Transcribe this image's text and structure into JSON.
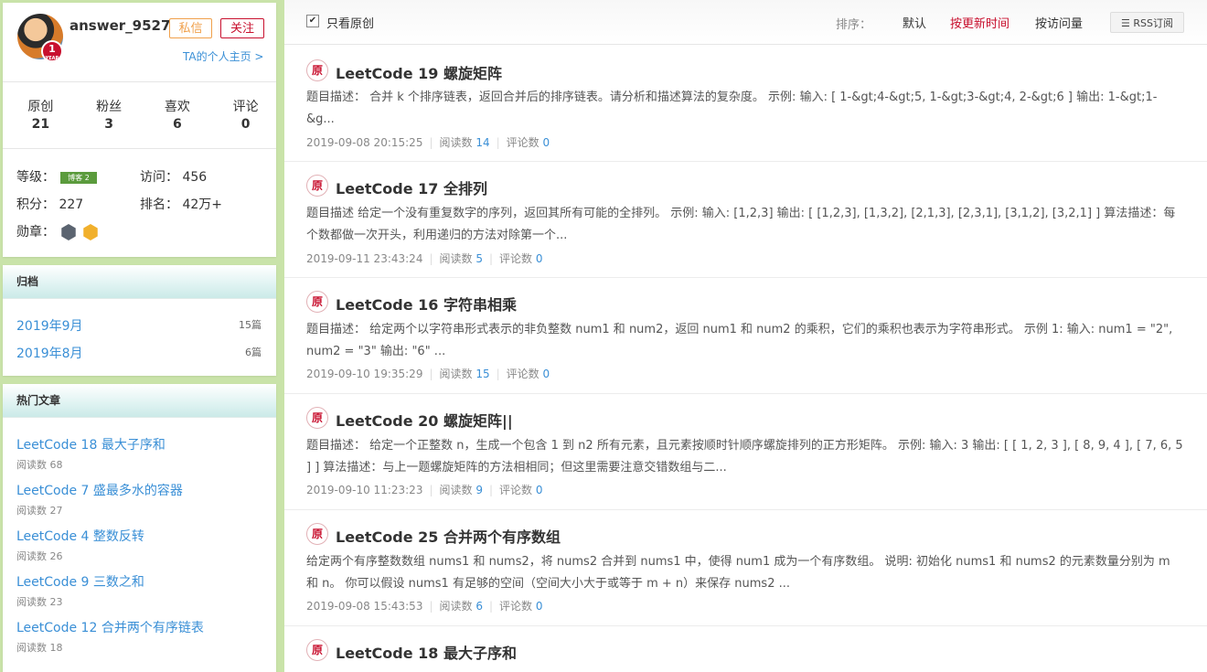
{
  "profile": {
    "username": "answer_9527",
    "level_badge_num": "1",
    "level_badge_word": "YEAR",
    "message_label": "私信",
    "follow_label": "关注",
    "homepage_label": "TA的个人主页 >",
    "stats": [
      {
        "label": "原创",
        "value": "21"
      },
      {
        "label": "粉丝",
        "value": "3"
      },
      {
        "label": "喜欢",
        "value": "6"
      },
      {
        "label": "评论",
        "value": "0"
      }
    ],
    "level_label": "等级：",
    "level_tag": "博客 2",
    "visits_label": "访问：",
    "visits_value": "456",
    "points_label": "积分：",
    "points_value": "227",
    "rank_label": "排名：",
    "rank_value": "42万+",
    "medals_label": "勋章："
  },
  "archive": {
    "title": "归档",
    "items": [
      {
        "label": "2019年9月",
        "count": "15篇"
      },
      {
        "label": "2019年8月",
        "count": "6篇"
      }
    ]
  },
  "hot": {
    "title": "热门文章",
    "items": [
      {
        "title": "LeetCode 18 最大子序和",
        "reads": "阅读数 68"
      },
      {
        "title": "LeetCode 7 盛最多水的容器",
        "reads": "阅读数 27"
      },
      {
        "title": "LeetCode 4 整数反转",
        "reads": "阅读数 26"
      },
      {
        "title": "LeetCode 9 三数之和",
        "reads": "阅读数 23"
      },
      {
        "title": "LeetCode 12 合并两个有序链表",
        "reads": "阅读数 18"
      }
    ]
  },
  "toolbar": {
    "only_original": "只看原创",
    "sort_label": "排序：",
    "sort_default": "默认",
    "sort_by_time": "按更新时间",
    "sort_by_views": "按访问量",
    "rss_label": "RSS订阅"
  },
  "posts": [
    {
      "badge": "原",
      "title": "LeetCode 19 螺旋矩阵",
      "desc": "题目描述： 合并 k 个排序链表，返回合并后的排序链表。请分析和描述算法的复杂度。 示例: 输入: [ 1-&gt;4-&gt;5, 1-&gt;3-&gt;4, 2-&gt;6 ] 输出: 1-&gt;1-&g...",
      "date": "2019-09-08 20:15:25",
      "read_label": "阅读数",
      "reads": "14",
      "comment_label": "评论数",
      "comments": "0"
    },
    {
      "badge": "原",
      "title": "LeetCode 17 全排列",
      "desc": "题目描述 给定一个没有重复数字的序列，返回其所有可能的全排列。 示例: 输入: [1,2,3] 输出: [ [1,2,3], [1,3,2], [2,1,3], [2,3,1], [3,1,2], [3,2,1] ] 算法描述：每个数都做一次开头，利用递归的方法对除第一个...",
      "date": "2019-09-11 23:43:24",
      "read_label": "阅读数",
      "reads": "5",
      "comment_label": "评论数",
      "comments": "0"
    },
    {
      "badge": "原",
      "title": "LeetCode 16 字符串相乘",
      "desc": "题目描述： 给定两个以字符串形式表示的非负整数 num1 和 num2，返回 num1 和 num2 的乘积，它们的乘积也表示为字符串形式。 示例 1: 输入: num1 = \"2\", num2 = \"3\" 输出: \"6\" ...",
      "date": "2019-09-10 19:35:29",
      "read_label": "阅读数",
      "reads": "15",
      "comment_label": "评论数",
      "comments": "0"
    },
    {
      "badge": "原",
      "title": "LeetCode 20 螺旋矩阵||",
      "desc": "题目描述： 给定一个正整数 n，生成一个包含 1 到 n2 所有元素，且元素按顺时针顺序螺旋排列的正方形矩阵。 示例: 输入: 3 输出: [ [ 1, 2, 3 ], [ 8, 9, 4 ], [ 7, 6, 5 ] ] 算法描述：与上一题螺旋矩阵的方法相相同；但这里需要注意交错数组与二...",
      "date": "2019-09-10 11:23:23",
      "read_label": "阅读数",
      "reads": "9",
      "comment_label": "评论数",
      "comments": "0"
    },
    {
      "badge": "原",
      "title": "LeetCode 25 合并两个有序数组",
      "desc": "给定两个有序整数数组 nums1 和 nums2，将 nums2 合并到 nums1 中，使得 num1 成为一个有序数组。 说明: 初始化 nums1 和 nums2 的元素数量分别为 m 和 n。 你可以假设 nums1 有足够的空间（空间大小大于或等于 m + n）来保存 nums2 ...",
      "date": "2019-09-08 15:43:53",
      "read_label": "阅读数",
      "reads": "6",
      "comment_label": "评论数",
      "comments": "0"
    },
    {
      "badge": "原",
      "title": "LeetCode 18 最大子序和"
    }
  ]
}
